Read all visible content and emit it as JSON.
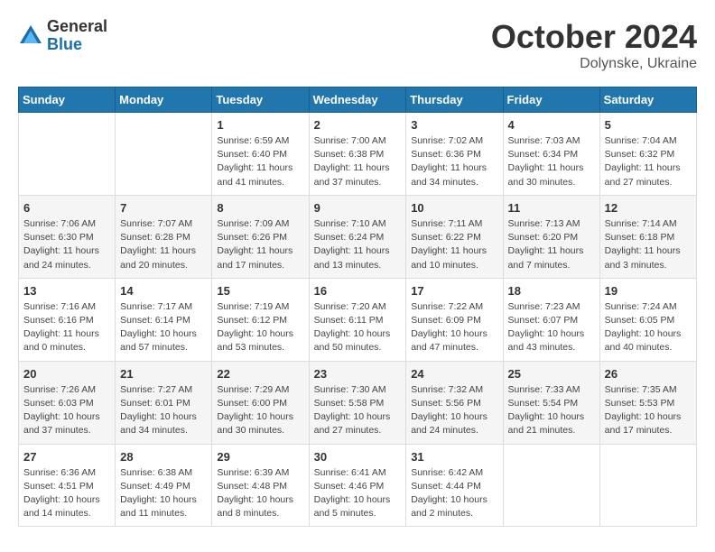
{
  "header": {
    "logo": {
      "general": "General",
      "blue": "Blue"
    },
    "title": "October 2024",
    "location": "Dolynske, Ukraine"
  },
  "calendar": {
    "days_of_week": [
      "Sunday",
      "Monday",
      "Tuesday",
      "Wednesday",
      "Thursday",
      "Friday",
      "Saturday"
    ],
    "weeks": [
      [
        {
          "day": "",
          "info": ""
        },
        {
          "day": "",
          "info": ""
        },
        {
          "day": "1",
          "info": "Sunrise: 6:59 AM\nSunset: 6:40 PM\nDaylight: 11 hours and 41 minutes."
        },
        {
          "day": "2",
          "info": "Sunrise: 7:00 AM\nSunset: 6:38 PM\nDaylight: 11 hours and 37 minutes."
        },
        {
          "day": "3",
          "info": "Sunrise: 7:02 AM\nSunset: 6:36 PM\nDaylight: 11 hours and 34 minutes."
        },
        {
          "day": "4",
          "info": "Sunrise: 7:03 AM\nSunset: 6:34 PM\nDaylight: 11 hours and 30 minutes."
        },
        {
          "day": "5",
          "info": "Sunrise: 7:04 AM\nSunset: 6:32 PM\nDaylight: 11 hours and 27 minutes."
        }
      ],
      [
        {
          "day": "6",
          "info": "Sunrise: 7:06 AM\nSunset: 6:30 PM\nDaylight: 11 hours and 24 minutes."
        },
        {
          "day": "7",
          "info": "Sunrise: 7:07 AM\nSunset: 6:28 PM\nDaylight: 11 hours and 20 minutes."
        },
        {
          "day": "8",
          "info": "Sunrise: 7:09 AM\nSunset: 6:26 PM\nDaylight: 11 hours and 17 minutes."
        },
        {
          "day": "9",
          "info": "Sunrise: 7:10 AM\nSunset: 6:24 PM\nDaylight: 11 hours and 13 minutes."
        },
        {
          "day": "10",
          "info": "Sunrise: 7:11 AM\nSunset: 6:22 PM\nDaylight: 11 hours and 10 minutes."
        },
        {
          "day": "11",
          "info": "Sunrise: 7:13 AM\nSunset: 6:20 PM\nDaylight: 11 hours and 7 minutes."
        },
        {
          "day": "12",
          "info": "Sunrise: 7:14 AM\nSunset: 6:18 PM\nDaylight: 11 hours and 3 minutes."
        }
      ],
      [
        {
          "day": "13",
          "info": "Sunrise: 7:16 AM\nSunset: 6:16 PM\nDaylight: 11 hours and 0 minutes."
        },
        {
          "day": "14",
          "info": "Sunrise: 7:17 AM\nSunset: 6:14 PM\nDaylight: 10 hours and 57 minutes."
        },
        {
          "day": "15",
          "info": "Sunrise: 7:19 AM\nSunset: 6:12 PM\nDaylight: 10 hours and 53 minutes."
        },
        {
          "day": "16",
          "info": "Sunrise: 7:20 AM\nSunset: 6:11 PM\nDaylight: 10 hours and 50 minutes."
        },
        {
          "day": "17",
          "info": "Sunrise: 7:22 AM\nSunset: 6:09 PM\nDaylight: 10 hours and 47 minutes."
        },
        {
          "day": "18",
          "info": "Sunrise: 7:23 AM\nSunset: 6:07 PM\nDaylight: 10 hours and 43 minutes."
        },
        {
          "day": "19",
          "info": "Sunrise: 7:24 AM\nSunset: 6:05 PM\nDaylight: 10 hours and 40 minutes."
        }
      ],
      [
        {
          "day": "20",
          "info": "Sunrise: 7:26 AM\nSunset: 6:03 PM\nDaylight: 10 hours and 37 minutes."
        },
        {
          "day": "21",
          "info": "Sunrise: 7:27 AM\nSunset: 6:01 PM\nDaylight: 10 hours and 34 minutes."
        },
        {
          "day": "22",
          "info": "Sunrise: 7:29 AM\nSunset: 6:00 PM\nDaylight: 10 hours and 30 minutes."
        },
        {
          "day": "23",
          "info": "Sunrise: 7:30 AM\nSunset: 5:58 PM\nDaylight: 10 hours and 27 minutes."
        },
        {
          "day": "24",
          "info": "Sunrise: 7:32 AM\nSunset: 5:56 PM\nDaylight: 10 hours and 24 minutes."
        },
        {
          "day": "25",
          "info": "Sunrise: 7:33 AM\nSunset: 5:54 PM\nDaylight: 10 hours and 21 minutes."
        },
        {
          "day": "26",
          "info": "Sunrise: 7:35 AM\nSunset: 5:53 PM\nDaylight: 10 hours and 17 minutes."
        }
      ],
      [
        {
          "day": "27",
          "info": "Sunrise: 6:36 AM\nSunset: 4:51 PM\nDaylight: 10 hours and 14 minutes."
        },
        {
          "day": "28",
          "info": "Sunrise: 6:38 AM\nSunset: 4:49 PM\nDaylight: 10 hours and 11 minutes."
        },
        {
          "day": "29",
          "info": "Sunrise: 6:39 AM\nSunset: 4:48 PM\nDaylight: 10 hours and 8 minutes."
        },
        {
          "day": "30",
          "info": "Sunrise: 6:41 AM\nSunset: 4:46 PM\nDaylight: 10 hours and 5 minutes."
        },
        {
          "day": "31",
          "info": "Sunrise: 6:42 AM\nSunset: 4:44 PM\nDaylight: 10 hours and 2 minutes."
        },
        {
          "day": "",
          "info": ""
        },
        {
          "day": "",
          "info": ""
        }
      ]
    ]
  }
}
